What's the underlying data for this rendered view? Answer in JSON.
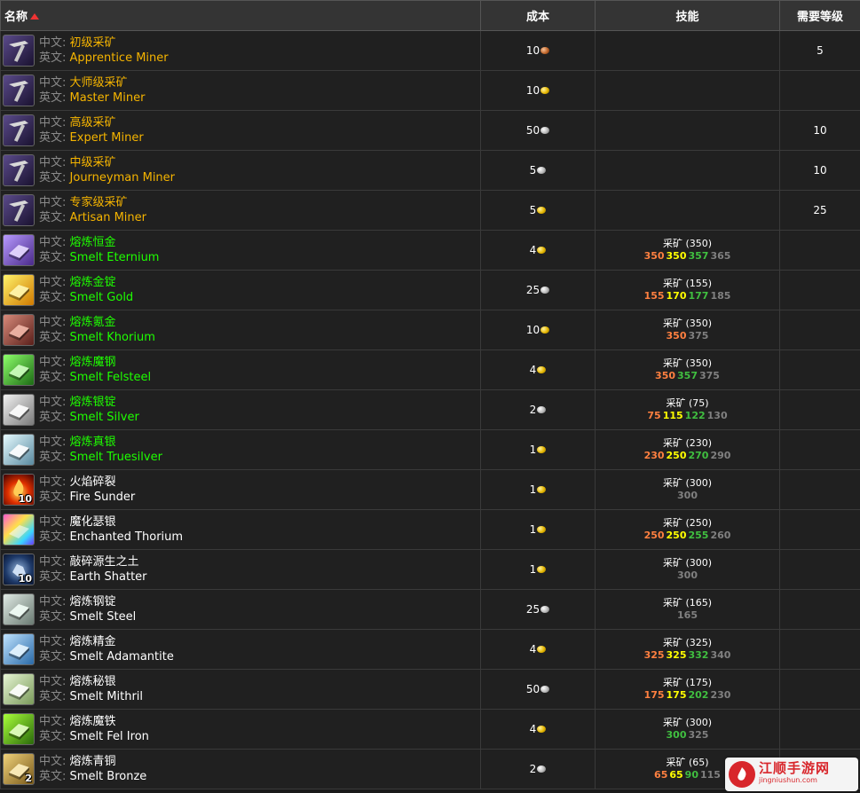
{
  "header": {
    "name": "名称",
    "cost": "成本",
    "skill": "技能",
    "level": "需要等级"
  },
  "labels": {
    "cn": "中文:",
    "en": "英文:"
  },
  "rows": [
    {
      "icon": "pickaxe-icon",
      "cn": "初级采矿",
      "en": "Apprentice Miner",
      "color": "orange",
      "cost": "10",
      "coin": "copper",
      "skill": "",
      "ranks": [],
      "level": "5"
    },
    {
      "icon": "pickaxe-icon",
      "cn": "大师级采矿",
      "en": "Master Miner",
      "color": "orange",
      "cost": "10",
      "coin": "gold",
      "skill": "",
      "ranks": [],
      "level": ""
    },
    {
      "icon": "pickaxe-icon",
      "cn": "高级采矿",
      "en": "Expert Miner",
      "color": "orange",
      "cost": "50",
      "coin": "silver",
      "skill": "",
      "ranks": [],
      "level": "10"
    },
    {
      "icon": "pickaxe-icon",
      "cn": "中级采矿",
      "en": "Journeyman Miner",
      "color": "orange",
      "cost": "5",
      "coin": "silver",
      "skill": "",
      "ranks": [],
      "level": "10"
    },
    {
      "icon": "pickaxe-icon",
      "cn": "专家级采矿",
      "en": "Artisan Miner",
      "color": "orange",
      "cost": "5",
      "coin": "gold",
      "skill": "",
      "ranks": [],
      "level": "25"
    },
    {
      "icon": "eternium-bar-icon",
      "cn": "熔炼恒金",
      "en": "Smelt Eternium",
      "color": "green",
      "cost": "4",
      "coin": "gold",
      "skill": "采矿 (350)",
      "ranks": [
        "350",
        "350",
        "357",
        "365"
      ],
      "level": ""
    },
    {
      "icon": "gold-bar-icon",
      "cn": "熔炼金锭",
      "en": "Smelt Gold",
      "color": "green",
      "cost": "25",
      "coin": "silver",
      "skill": "采矿 (155)",
      "ranks": [
        "155",
        "170",
        "177",
        "185"
      ],
      "level": ""
    },
    {
      "icon": "khorium-bar-icon",
      "cn": "熔炼氪金",
      "en": "Smelt Khorium",
      "color": "green",
      "cost": "10",
      "coin": "gold",
      "skill": "采矿 (350)",
      "ranks": [
        "350",
        "",
        "",
        "375"
      ],
      "level": ""
    },
    {
      "icon": "felsteel-bar-icon",
      "cn": "熔炼魔钢",
      "en": "Smelt Felsteel",
      "color": "green",
      "cost": "4",
      "coin": "gold",
      "skill": "采矿 (350)",
      "ranks": [
        "350",
        "",
        "357",
        "375"
      ],
      "level": ""
    },
    {
      "icon": "silver-bar-icon",
      "cn": "熔炼银锭",
      "en": "Smelt Silver",
      "color": "green",
      "cost": "2",
      "coin": "silver",
      "skill": "采矿 (75)",
      "ranks": [
        "75",
        "115",
        "122",
        "130"
      ],
      "level": ""
    },
    {
      "icon": "truesilver-bar-icon",
      "cn": "熔炼真银",
      "en": "Smelt Truesilver",
      "color": "green",
      "cost": "1",
      "coin": "gold",
      "skill": "采矿 (230)",
      "ranks": [
        "230",
        "250",
        "270",
        "290"
      ],
      "level": ""
    },
    {
      "icon": "fire-icon",
      "badge": "10",
      "cn": "火焰碎裂",
      "en": "Fire Sunder",
      "color": "white",
      "cost": "1",
      "coin": "gold",
      "skill": "采矿 (300)",
      "ranks": [
        "",
        "",
        "",
        "300"
      ],
      "level": ""
    },
    {
      "icon": "enchanted-thorium-icon",
      "cn": "魔化瑟银",
      "en": "Enchanted Thorium",
      "color": "white",
      "cost": "1",
      "coin": "gold",
      "skill": "采矿 (250)",
      "ranks": [
        "250",
        "250",
        "255",
        "260"
      ],
      "level": ""
    },
    {
      "icon": "earth-icon",
      "badge": "10",
      "cn": "敲碎源生之土",
      "en": "Earth Shatter",
      "color": "white",
      "cost": "1",
      "coin": "gold",
      "skill": "采矿 (300)",
      "ranks": [
        "",
        "",
        "",
        "300"
      ],
      "level": ""
    },
    {
      "icon": "steel-bar-icon",
      "cn": "熔炼钢锭",
      "en": "Smelt Steel",
      "color": "white",
      "cost": "25",
      "coin": "silver",
      "skill": "采矿 (165)",
      "ranks": [
        "",
        "",
        "",
        "165"
      ],
      "level": ""
    },
    {
      "icon": "adamantite-bar-icon",
      "cn": "熔炼精金",
      "en": "Smelt Adamantite",
      "color": "white",
      "cost": "4",
      "coin": "gold",
      "skill": "采矿 (325)",
      "ranks": [
        "325",
        "325",
        "332",
        "340"
      ],
      "level": ""
    },
    {
      "icon": "mithril-bar-icon",
      "cn": "熔炼秘银",
      "en": "Smelt Mithril",
      "color": "white",
      "cost": "50",
      "coin": "silver",
      "skill": "采矿 (175)",
      "ranks": [
        "175",
        "175",
        "202",
        "230"
      ],
      "level": ""
    },
    {
      "icon": "fel-iron-bar-icon",
      "cn": "熔炼魔铁",
      "en": "Smelt Fel Iron",
      "color": "white",
      "cost": "4",
      "coin": "gold",
      "skill": "采矿 (300)",
      "ranks": [
        "",
        "",
        "300",
        "325"
      ],
      "level": ""
    },
    {
      "icon": "bronze-bar-icon",
      "badge": "2",
      "cn": "熔炼青铜",
      "en": "Smelt Bronze",
      "color": "white",
      "cost": "2",
      "coin": "silver",
      "skill": "采矿 (65)",
      "ranks": [
        "65",
        "65",
        "90",
        "115"
      ],
      "level": ""
    }
  ],
  "watermark": {
    "title": "江顺手游网",
    "url": "jingniushun.com"
  },
  "colors": {
    "orange_name": "#f5b400",
    "green_name": "#1eff00",
    "rank_orange": "#ff8040",
    "rank_yellow": "#ffff00",
    "rank_green": "#40bf40",
    "rank_gray": "#808080"
  }
}
